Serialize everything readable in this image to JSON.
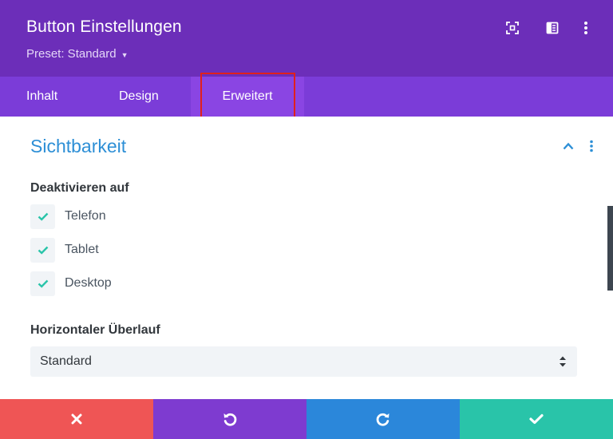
{
  "header": {
    "title": "Button Einstellungen",
    "preset_label": "Preset: Standard",
    "icons": [
      "focus-icon",
      "split-view-icon",
      "more-options-icon"
    ]
  },
  "tabs": [
    {
      "label": "Inhalt",
      "active": false
    },
    {
      "label": "Design",
      "active": false
    },
    {
      "label": "Erweitert",
      "active": true
    }
  ],
  "section": {
    "title": "Sichtbarkeit",
    "collapsed": false
  },
  "disable_on": {
    "label": "Deaktivieren auf",
    "options": [
      {
        "label": "Telefon",
        "checked": true
      },
      {
        "label": "Tablet",
        "checked": true
      },
      {
        "label": "Desktop",
        "checked": true
      }
    ]
  },
  "overflow": {
    "label": "Horizontaler Überlauf",
    "value": "Standard"
  },
  "footer": {
    "buttons": [
      "close-icon",
      "undo-icon",
      "redo-icon",
      "checkmark-icon"
    ]
  },
  "colors": {
    "header_bg": "#6c2eb9",
    "tabs_bg": "#7b3cd8",
    "active_tab_bg": "#8a45e3",
    "section_title": "#2d8fd6",
    "check_color": "#29c4a9",
    "cancel": "#ef5555",
    "undo": "#7e3bd0",
    "redo": "#2b87da",
    "save": "#29c4a9"
  }
}
